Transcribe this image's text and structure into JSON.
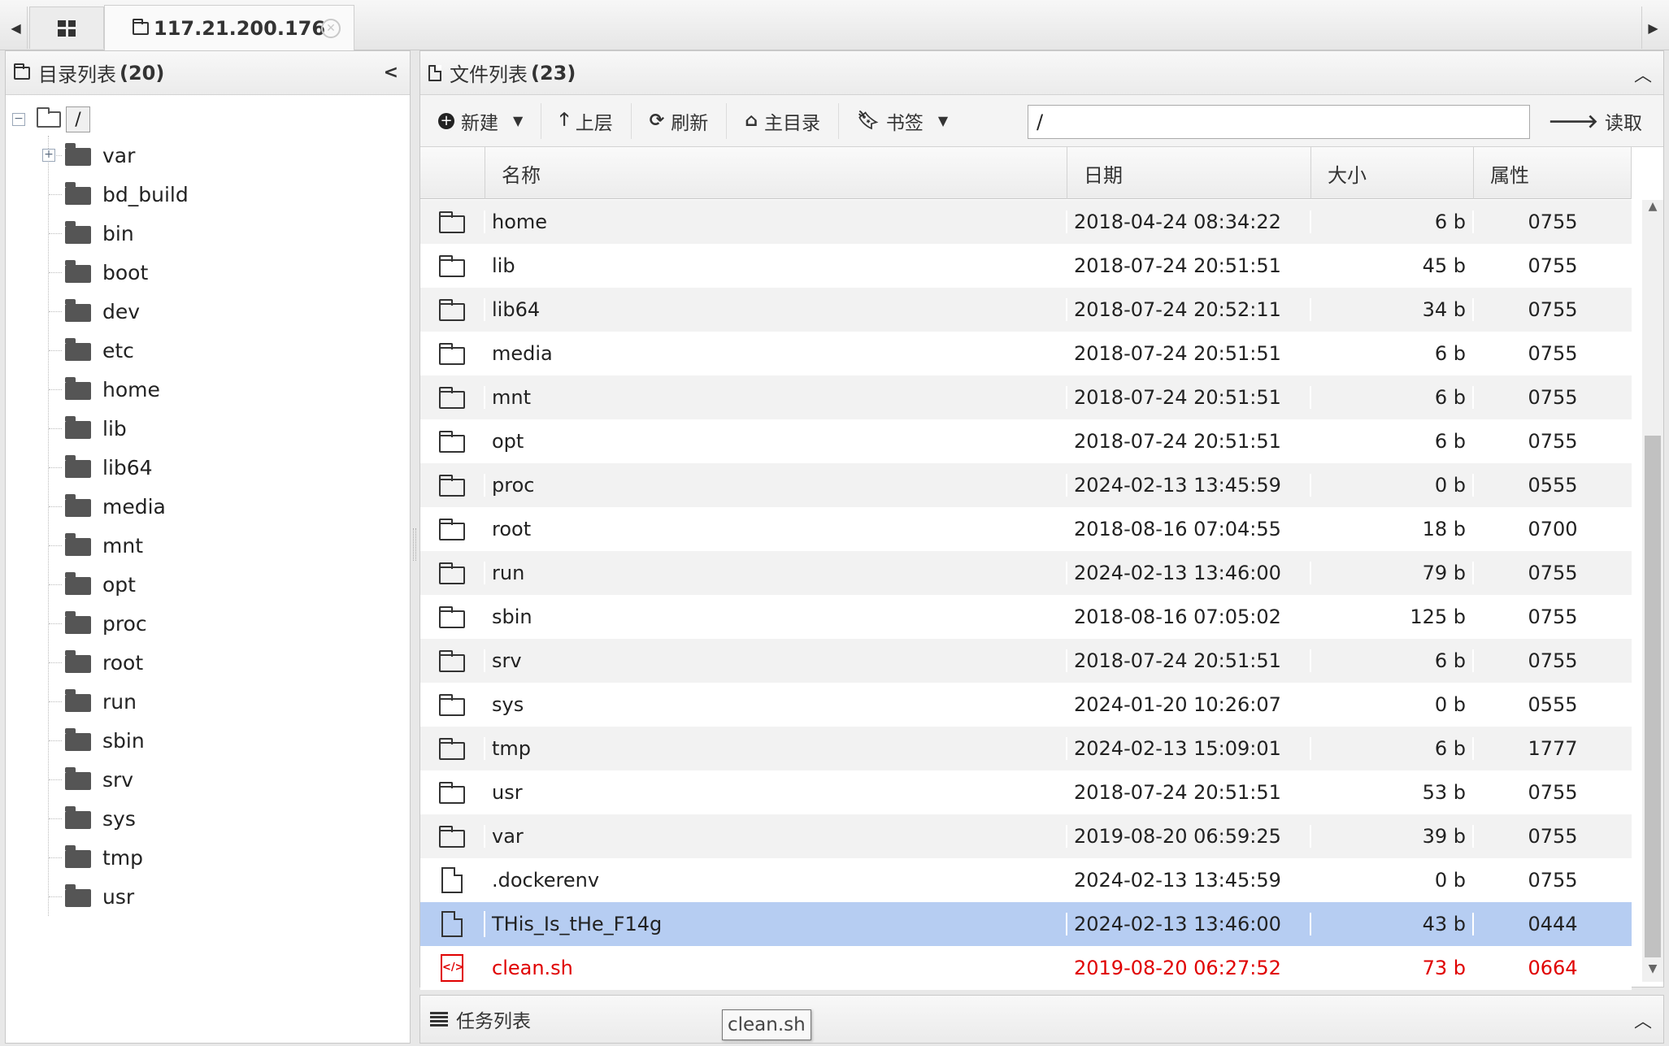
{
  "tabs": {
    "host_label": "117.21.200.176"
  },
  "left_panel": {
    "title": "目录列表",
    "count": "(20)",
    "root": "/",
    "items": [
      "var",
      "bd_build",
      "bin",
      "boot",
      "dev",
      "etc",
      "home",
      "lib",
      "lib64",
      "media",
      "mnt",
      "opt",
      "proc",
      "root",
      "run",
      "sbin",
      "srv",
      "sys",
      "tmp",
      "usr"
    ]
  },
  "right_panel": {
    "title": "文件列表",
    "count": "(23)",
    "toolbar": {
      "new_label": "新建",
      "up_label": "上层",
      "refresh_label": "刷新",
      "home_label": "主目录",
      "bookmark_label": "书签",
      "path_value": "/",
      "read_label": "读取"
    },
    "columns": {
      "name": "名称",
      "date": "日期",
      "size": "大小",
      "perm": "属性"
    },
    "rows": [
      {
        "type": "folder",
        "name": "home",
        "date": "2018-04-24 08:34:22",
        "size": "6 b",
        "perm": "0755"
      },
      {
        "type": "folder",
        "name": "lib",
        "date": "2018-07-24 20:51:51",
        "size": "45 b",
        "perm": "0755"
      },
      {
        "type": "folder",
        "name": "lib64",
        "date": "2018-07-24 20:52:11",
        "size": "34 b",
        "perm": "0755"
      },
      {
        "type": "folder",
        "name": "media",
        "date": "2018-07-24 20:51:51",
        "size": "6 b",
        "perm": "0755"
      },
      {
        "type": "folder",
        "name": "mnt",
        "date": "2018-07-24 20:51:51",
        "size": "6 b",
        "perm": "0755"
      },
      {
        "type": "folder",
        "name": "opt",
        "date": "2018-07-24 20:51:51",
        "size": "6 b",
        "perm": "0755"
      },
      {
        "type": "folder",
        "name": "proc",
        "date": "2024-02-13 13:45:59",
        "size": "0 b",
        "perm": "0555"
      },
      {
        "type": "folder",
        "name": "root",
        "date": "2018-08-16 07:04:55",
        "size": "18 b",
        "perm": "0700"
      },
      {
        "type": "folder",
        "name": "run",
        "date": "2024-02-13 13:46:00",
        "size": "79 b",
        "perm": "0755"
      },
      {
        "type": "folder",
        "name": "sbin",
        "date": "2018-08-16 07:05:02",
        "size": "125 b",
        "perm": "0755"
      },
      {
        "type": "folder",
        "name": "srv",
        "date": "2018-07-24 20:51:51",
        "size": "6 b",
        "perm": "0755"
      },
      {
        "type": "folder",
        "name": "sys",
        "date": "2024-01-20 10:26:07",
        "size": "0 b",
        "perm": "0555"
      },
      {
        "type": "folder",
        "name": "tmp",
        "date": "2024-02-13 15:09:01",
        "size": "6 b",
        "perm": "1777"
      },
      {
        "type": "folder",
        "name": "usr",
        "date": "2018-07-24 20:51:51",
        "size": "53 b",
        "perm": "0755"
      },
      {
        "type": "folder",
        "name": "var",
        "date": "2019-08-20 06:59:25",
        "size": "39 b",
        "perm": "0755"
      },
      {
        "type": "file",
        "name": ".dockerenv",
        "date": "2024-02-13 13:45:59",
        "size": "0 b",
        "perm": "0755"
      },
      {
        "type": "file",
        "name": "THis_Is_tHe_F14g",
        "date": "2024-02-13 13:46:00",
        "size": "43 b",
        "perm": "0444",
        "selected": true
      },
      {
        "type": "script",
        "name": "clean.sh",
        "date": "2019-08-20 06:27:52",
        "size": "73 b",
        "perm": "0664",
        "highlight": true
      }
    ]
  },
  "task_panel": {
    "title": "任务列表"
  },
  "tooltip": {
    "text": "clean.sh"
  },
  "colors": {
    "selected_row": "#b6cdf2",
    "highlight_text": "#e00000"
  }
}
